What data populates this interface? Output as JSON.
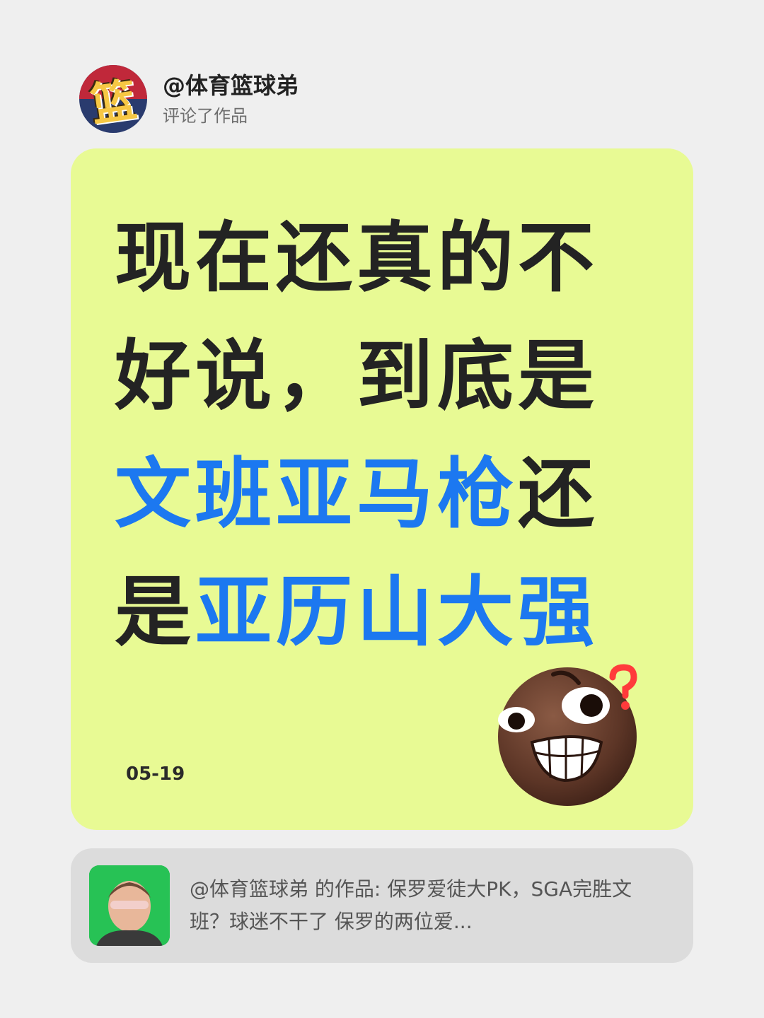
{
  "author": {
    "username": "@体育篮球弟",
    "action": "评论了作品",
    "avatar_icon": "basketball-logo-icon",
    "avatar_glyph": "篮"
  },
  "comment": {
    "segments": [
      {
        "text": "现在还真的不好说，到底是",
        "highlight": false
      },
      {
        "text": "文班亚马枪",
        "highlight": true
      },
      {
        "text": "还是",
        "highlight": false
      },
      {
        "text": "亚历山大强",
        "highlight": true
      }
    ],
    "date": "05-19",
    "emoji_icon": "confused-grin-emoji-icon",
    "colors": {
      "card_bg": "#e8fa94",
      "text": "#232323",
      "highlight": "#1c78f0"
    }
  },
  "referenced_work": {
    "thumbnail_icon": "video-thumbnail-person-icon",
    "text": "@体育篮球弟 的作品: 保罗爱徒大PK，SGA完胜文班？球迷不干了 保罗的两位爱..."
  }
}
